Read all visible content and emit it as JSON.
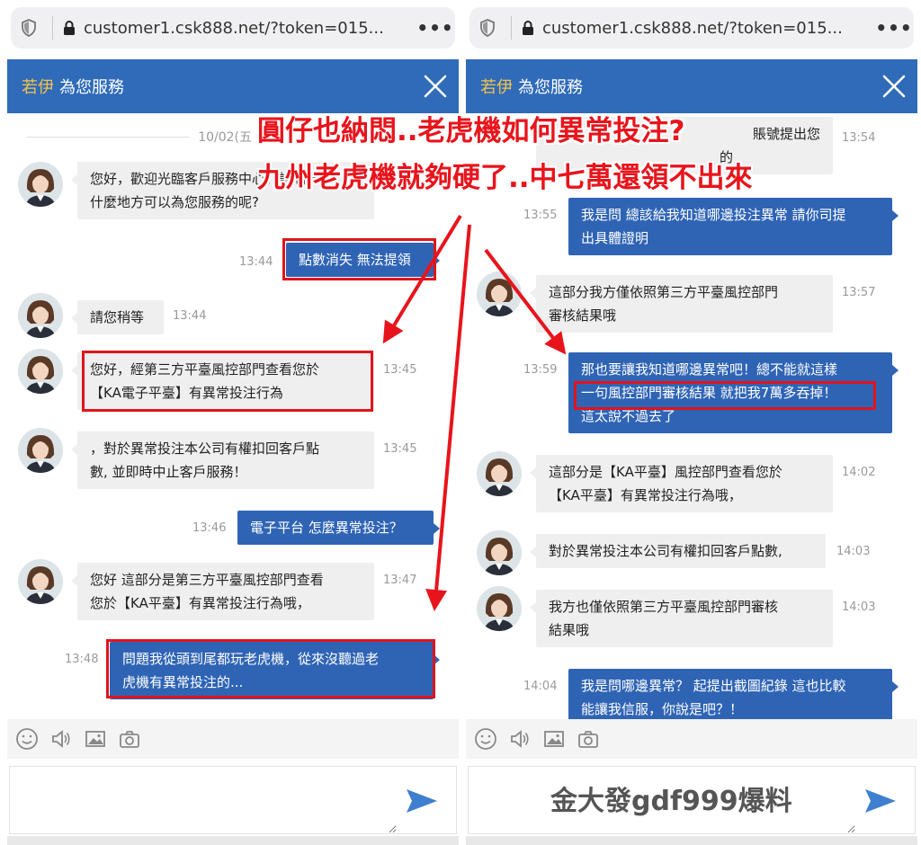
{
  "browser": {
    "url": "customer1.csk888.net/?token=015...",
    "shield_icon": "shield-icon",
    "lock_icon": "lock-icon",
    "more_icon": "more-dots-icon",
    "more_label": "•••"
  },
  "chat_header": {
    "agent_name": "若伊",
    "service_text": "為您服務",
    "close_icon": "close-icon"
  },
  "colors": {
    "header_blue": "#2f6bb8",
    "outgoing_bubble": "#2f64b5",
    "incoming_bubble": "#efefef",
    "agent_name": "#f5c24a",
    "annotation_red": "#e0141c"
  },
  "left_panel": {
    "date_divider": "10/02(五",
    "messages": [
      {
        "from": "agent",
        "lines": [
          "您好，歡迎光臨客戶服務中心，請問有",
          "什麼地方可以為您服務的呢?"
        ],
        "time": ""
      },
      {
        "from": "user",
        "lines": [
          "點數消失 無法提領"
        ],
        "time": "13:44",
        "highlight": true
      },
      {
        "from": "agent",
        "lines": [
          "請您稍等"
        ],
        "time": "13:44"
      },
      {
        "from": "agent",
        "lines": [
          "您好，經第三方平臺風控部門查看您於",
          "【KA電子平臺】有異常投注行為"
        ],
        "time": "13:45",
        "highlight": true
      },
      {
        "from": "agent",
        "lines": [
          "，對於異常投注本公司有權扣回客戶點",
          "數, 並即時中止客戶服務！"
        ],
        "time": "13:45"
      },
      {
        "from": "user",
        "lines": [
          "電子平台 怎麼異常投注？"
        ],
        "time": "13:46"
      },
      {
        "from": "agent",
        "lines": [
          "您好 這部分是第三方平臺風控部門查看",
          "您於【KA平臺】有異常投注行為哦，"
        ],
        "time": "13:47"
      },
      {
        "from": "user",
        "lines": [
          "問題我從頭到尾都玩老虎機，從來沒聽過老",
          "虎機有異常投注的..."
        ],
        "time": "13:48",
        "highlight": true
      }
    ]
  },
  "right_panel": {
    "messages": [
      {
        "from": "agent",
        "lines": [
          "賬號提出您",
          "的"
        ],
        "time": "13:54"
      },
      {
        "from": "user",
        "lines": [
          "我是問 總該給我知道哪邊投注異常 請你司提",
          "出具體證明"
        ],
        "time": "13:55"
      },
      {
        "from": "agent",
        "lines": [
          "這部分我方僅依照第三方平臺風控部門",
          "審核結果哦"
        ],
        "time": "13:57"
      },
      {
        "from": "user",
        "lines": [
          "那也要讓我知道哪邊異常吧！總不能就這樣",
          "一句風控部門審核結果 就把我7萬多吞掉！",
          "這太說不過去了"
        ],
        "time": "13:59",
        "highlight_line": 1
      },
      {
        "from": "agent",
        "lines": [
          "這部分是【KA平臺】風控部門查看您於",
          "【KA平臺】有異常投注行為哦，"
        ],
        "time": "14:02"
      },
      {
        "from": "agent",
        "lines": [
          "對於異常投注本公司有權扣回客戶點數,"
        ],
        "time": "14:03"
      },
      {
        "from": "agent",
        "lines": [
          "我方也僅依照第三方平臺風控部門審核",
          "結果哦"
        ],
        "time": "14:03"
      },
      {
        "from": "user",
        "lines": [
          "我是問哪邊異常？ 起提出截圖紀錄 這也比較",
          "能讓我信服，你說是吧？！"
        ],
        "time": "14:04"
      }
    ]
  },
  "toolbar": {
    "icons": [
      "smiley-icon",
      "speaker-icon",
      "image-icon",
      "camera-icon"
    ]
  },
  "composer": {
    "placeholder": "",
    "send_icon": "send-arrow-icon"
  },
  "annotations": {
    "caption_line1": "圓仔也納悶..老虎機如何異常投注?",
    "caption_line2": "九州老虎機就夠硬了..中七萬還領不出來",
    "watermark": "金大發gdf999爆料"
  }
}
